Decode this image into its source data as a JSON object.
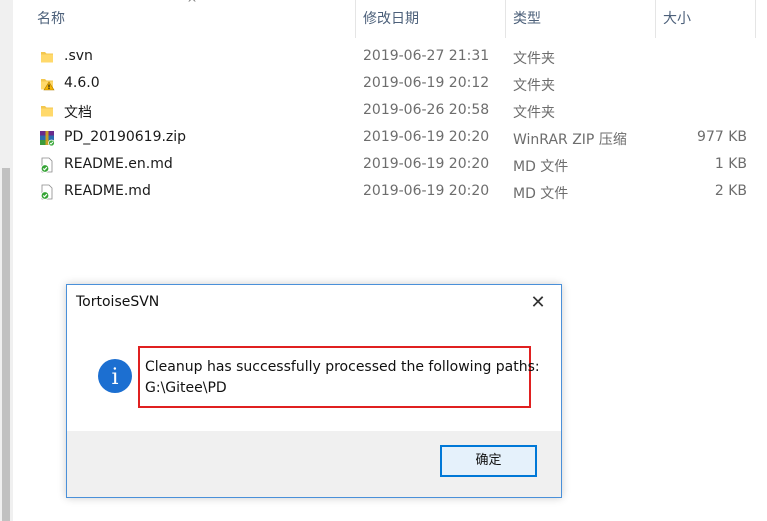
{
  "columns": {
    "name": "名称",
    "modified": "修改日期",
    "type": "类型",
    "size": "大小"
  },
  "sort_indicator": "^",
  "files": [
    {
      "name": ".svn",
      "modified": "2019-06-27 21:31",
      "type": "文件夹",
      "size": "",
      "icon": "folder-icon"
    },
    {
      "name": "4.6.0",
      "modified": "2019-06-19 20:12",
      "type": "文件夹",
      "size": "",
      "icon": "folder-warning-icon"
    },
    {
      "name": "文档",
      "modified": "2019-06-26 20:58",
      "type": "文件夹",
      "size": "",
      "icon": "folder-icon"
    },
    {
      "name": "PD_20190619.zip",
      "modified": "2019-06-19 20:20",
      "type": "WinRAR ZIP 压缩",
      "size": "977 KB",
      "icon": "zip-archive-icon"
    },
    {
      "name": "README.en.md",
      "modified": "2019-06-19 20:20",
      "type": "MD 文件",
      "size": "1 KB",
      "icon": "md-file-svn-ok-icon"
    },
    {
      "name": "README.md",
      "modified": "2019-06-19 20:20",
      "type": "MD 文件",
      "size": "2 KB",
      "icon": "md-file-svn-ok-icon"
    }
  ],
  "dialog": {
    "title": "TortoiseSVN",
    "close_glyph": "✕",
    "message_line1": "Cleanup has successfully processed the following paths:",
    "message_line2": "G:\\Gitee\\PD",
    "info_glyph": "i",
    "ok_label": "确定"
  },
  "colors": {
    "accent": "#0078d7",
    "highlight": "#e02020",
    "info": "#1c6fd1"
  }
}
